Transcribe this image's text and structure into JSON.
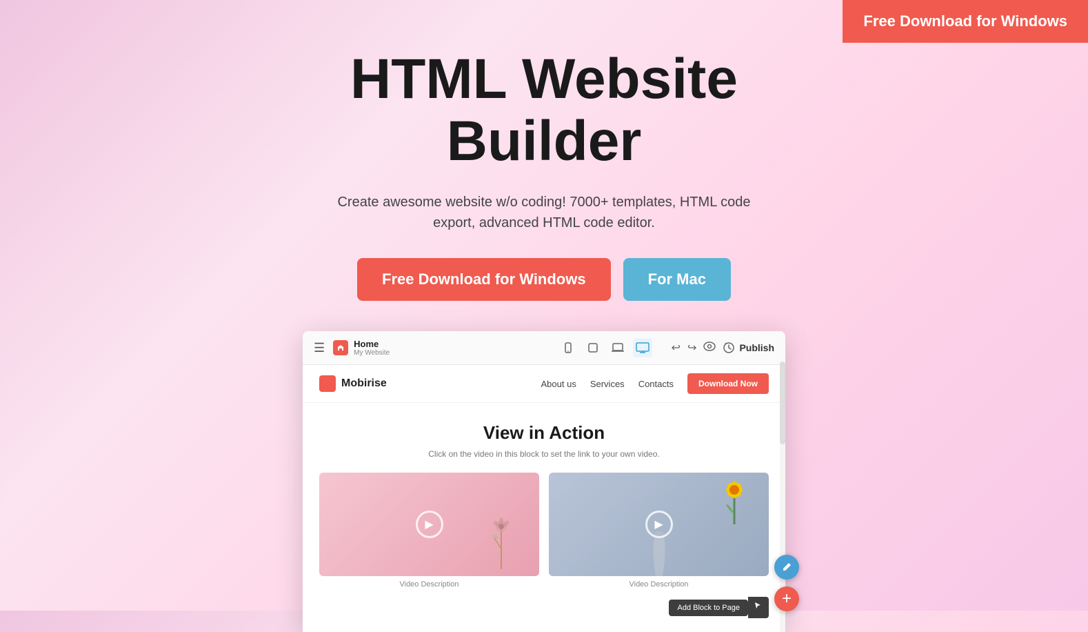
{
  "topBar": {
    "download_label": "Free Download for Windows"
  },
  "hero": {
    "title_line1": "HTML Website",
    "title_line2": "Builder",
    "subtitle": "Create awesome website w/o coding! 7000+ templates, HTML code export, advanced HTML code editor.",
    "btn_windows": "Free Download for Windows",
    "btn_mac": "For Mac"
  },
  "appPreview": {
    "toolbar": {
      "menu_icon": "☰",
      "home_title": "Home",
      "home_subtitle": "My Website",
      "device_mobile": "📱",
      "device_tablet": "📟",
      "device_laptop": "💻",
      "device_desktop": "🖥",
      "action_undo": "↩",
      "action_redo": "↪",
      "action_preview": "👁",
      "publish_label": "Publish"
    },
    "innerWebsite": {
      "brand_name": "Mobirise",
      "nav_links": [
        "About us",
        "Services",
        "Contacts"
      ],
      "nav_cta": "Download Now",
      "content_title": "View in Action",
      "content_subtitle": "Click on the video in this block to set the link to your own video.",
      "video1_desc": "Video Description",
      "video2_desc": "Video Description",
      "add_block_label": "Add Block to Page"
    }
  }
}
